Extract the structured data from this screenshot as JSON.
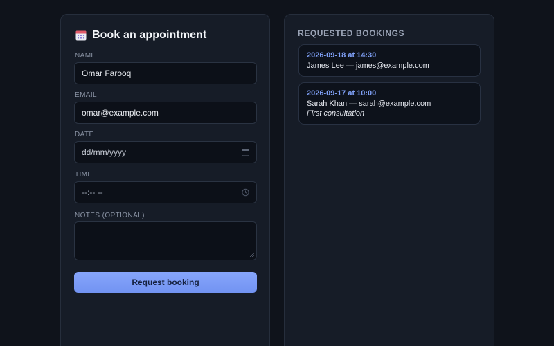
{
  "form": {
    "title": "Book an appointment",
    "title_icon": "calendar-icon",
    "name": {
      "label": "NAME",
      "value": "Omar Farooq"
    },
    "email": {
      "label": "EMAIL",
      "value": "omar@example.com"
    },
    "date": {
      "label": "DATE",
      "placeholder": "dd/mm/yyyy",
      "icon": "calendar-picker-icon"
    },
    "time": {
      "label": "TIME",
      "placeholder": "--:-- --",
      "icon": "clock-icon"
    },
    "notes": {
      "label": "NOTES (OPTIONAL)",
      "value": ""
    },
    "submit_label": "Request booking"
  },
  "bookings": {
    "title": "REQUESTED BOOKINGS",
    "items": [
      {
        "when": "2026-09-18 at 14:30",
        "who": "James Lee — james@example.com",
        "note": ""
      },
      {
        "when": "2026-09-17 at 10:00",
        "who": "Sarah Khan — sarah@example.com",
        "note": "First consultation"
      }
    ]
  },
  "colors": {
    "background": "#0f131b",
    "panel": "#161c27",
    "accent": "#7c9df7",
    "date_text": "#7fa0f6"
  }
}
